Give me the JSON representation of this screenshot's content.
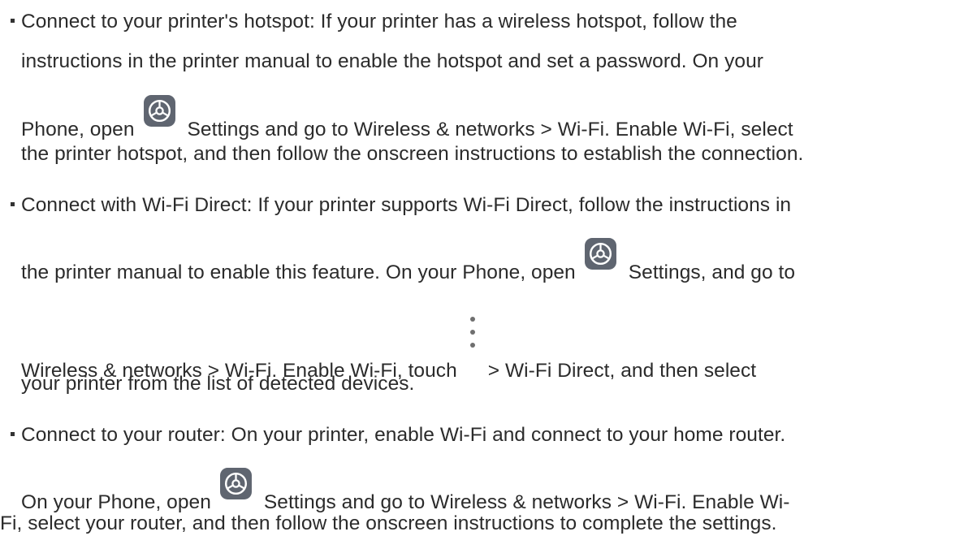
{
  "items": [
    {
      "line1": "Connect to your printer's hotspot: If your printer has a wireless hotspot, follow the",
      "line2": "instructions in the printer manual to enable the hotspot and set a password. On your",
      "line3_before": "Phone, open",
      "line3_after": "Settings and go to Wireless & networks > Wi-Fi. Enable Wi-Fi, select",
      "line4": "the printer hotspot, and then follow the onscreen instructions to establish the connection."
    },
    {
      "line1": "Connect with Wi-Fi Direct: If your printer supports Wi-Fi Direct, follow the instructions in",
      "line2_before": "the printer manual to enable this feature. On your Phone, open",
      "line2_after": "Settings, and go to",
      "line3_before": "Wireless & networks > Wi-Fi. Enable Wi-Fi, touch",
      "line3_after": "> Wi-Fi Direct, and then select",
      "line4": "your printer from the list of detected devices."
    },
    {
      "line1": "Connect to your router: On your printer, enable Wi-Fi and connect to your home router.",
      "line2_before": "On your Phone, open",
      "line2_after": "Settings and go to Wireless & networks > Wi-Fi. Enable Wi-",
      "line3": "Fi, select your router, and then follow the onscreen instructions to complete the settings."
    }
  ],
  "icons": {
    "settings": "settings-gear-icon",
    "more": "more-vertical-icon"
  },
  "colors": {
    "text": "#2b2b2b",
    "icon_bg": "#5f6570"
  }
}
